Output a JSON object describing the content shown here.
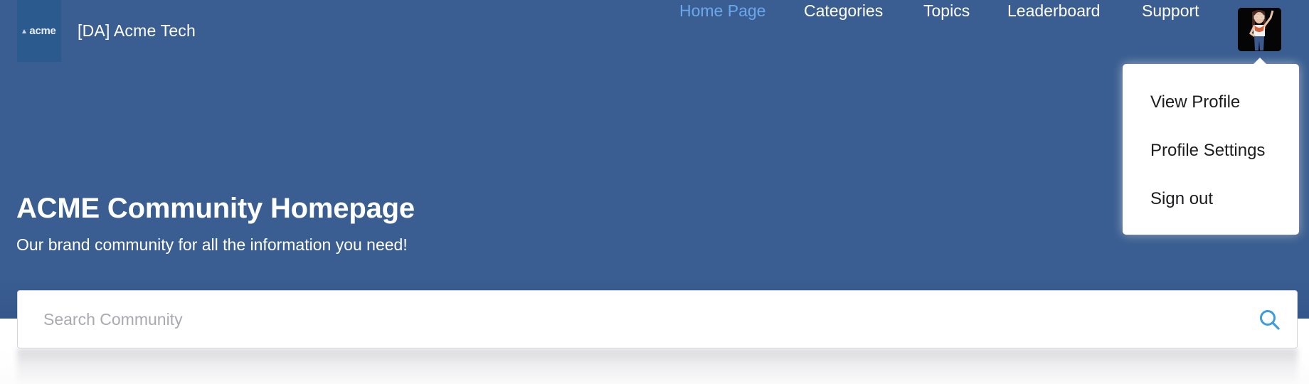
{
  "header": {
    "logo_text": "acme",
    "site_name": "[DA] Acme Tech",
    "nav": [
      {
        "label": "Home Page",
        "active": true
      },
      {
        "label": "Categories",
        "active": false
      },
      {
        "label": "Topics",
        "active": false
      },
      {
        "label": "Leaderboard",
        "active": false
      },
      {
        "label": "Support",
        "active": false
      }
    ],
    "avatar_icon": "user-avatar-cartoon"
  },
  "profile_menu": {
    "items": [
      {
        "label": "View Profile"
      },
      {
        "label": "Profile Settings"
      },
      {
        "label": "Sign out"
      }
    ]
  },
  "hero": {
    "title": "ACME Community Homepage",
    "subtitle": "Our brand community for all the information you need!"
  },
  "search": {
    "value": "",
    "placeholder": "Search Community",
    "icon": "search-icon"
  },
  "colors": {
    "hero_bg": "#3a5e91",
    "logo_bg": "#2a5a8e",
    "nav_active": "#6aa8ec",
    "search_icon": "#3d9be0"
  }
}
